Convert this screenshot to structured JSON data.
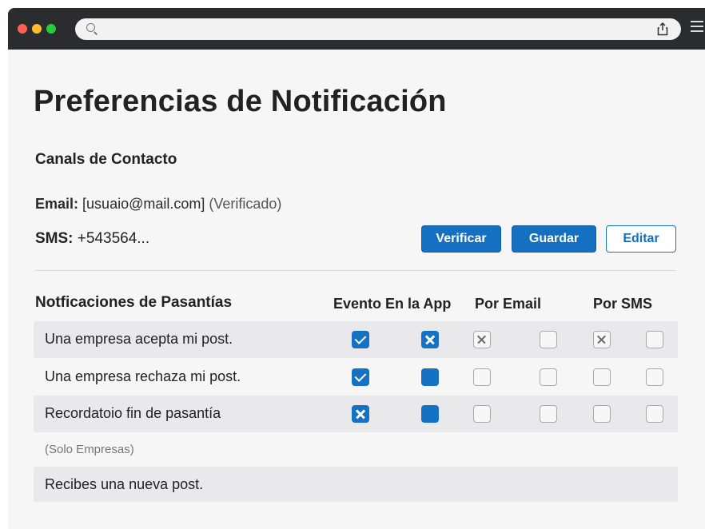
{
  "browser": {
    "url": "",
    "icons": [
      "search-icon",
      "share-icon",
      "menu-icon"
    ]
  },
  "page": {
    "title": "Preferencias de Notificación"
  },
  "contact": {
    "section_title": "Canals de Contacto",
    "email_label": "Email:",
    "email_value": "[usuaio@mail.com]",
    "email_status": "(Verificado)",
    "sms_label": "SMS:",
    "sms_value": "+543564...",
    "buttons": {
      "verify": "Verificar",
      "save": "Guardar",
      "edit": "Editar"
    }
  },
  "notifications": {
    "section_title": "Notficaciones de Pasantías",
    "columns": {
      "evento": "Evento",
      "app": "En la App",
      "email": "Por Email",
      "sms": "Por SMS"
    },
    "rows": [
      {
        "label": "Una empresa acepta mi post.",
        "states": [
          "checked",
          "x-blue",
          "x-gray",
          "empty",
          "x-gray",
          "empty"
        ]
      },
      {
        "label": "Una empresa rechaza mi post.",
        "states": [
          "checked",
          "filled",
          "empty",
          "empty",
          "empty",
          "empty"
        ]
      },
      {
        "label": "Recordatoio fin de pasantía",
        "states": [
          "x-blue",
          "filled",
          "empty",
          "empty",
          "empty",
          "empty"
        ]
      }
    ],
    "note": "(Solo Empresas)",
    "last_row_label": "Recibes una nueva post."
  },
  "colors": {
    "accent": "#1570c2",
    "chrome": "#2b2c2f",
    "page_bg": "#f6f6f7",
    "row_shade": "#e9e9eb"
  }
}
